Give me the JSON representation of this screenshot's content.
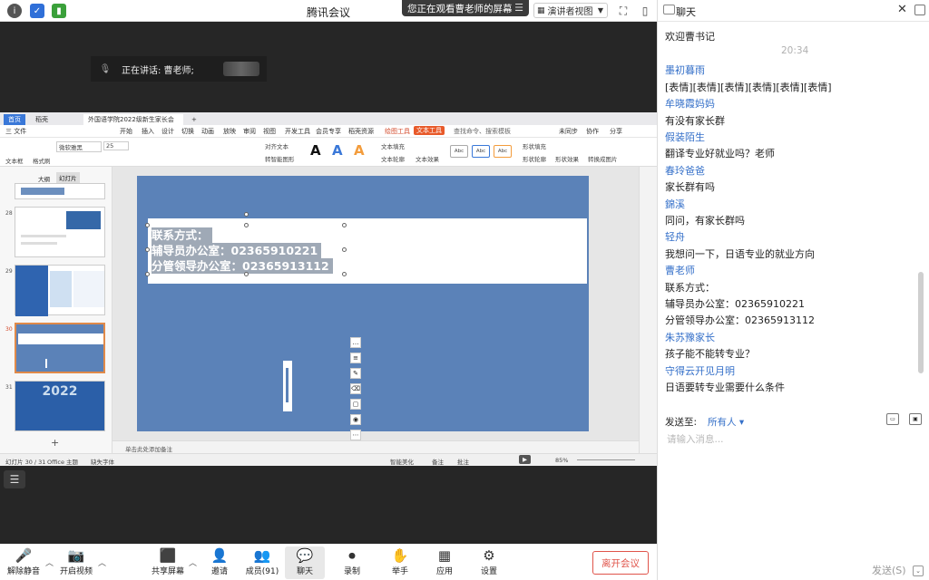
{
  "window": {
    "title": "腾讯会议",
    "viewing_notice": "您正在观看曹老师的屏幕",
    "presenter_view": "演讲者视图"
  },
  "speaking": {
    "label": "正在讲话: 曹老师;"
  },
  "wps": {
    "tabs": [
      "首页",
      "稻壳",
      "外国语学院2022级新生家长会(1)"
    ],
    "menu": [
      "三 文件",
      "开始",
      "插入",
      "设计",
      "切换",
      "动画",
      "放映",
      "审阅",
      "视图",
      "开发工具",
      "会员专享",
      "稻壳资源",
      "绘图工具",
      "文本工具",
      "查找命令、搜索模板",
      "未同步",
      "协作",
      "分享"
    ],
    "ribbon": {
      "font": "微软雅黑",
      "size": "25",
      "textbox": "文本框",
      "format": "格式刷",
      "align": "对齐文本",
      "convert": "转智能图形",
      "fill_text": "文本填充",
      "outline_text": "文本轮廓",
      "effect_text": "文本效果",
      "shape_fill": "形状填充",
      "shape_outline": "形状轮廓",
      "shape_effect": "形状效果",
      "convert_image": "转换成图片",
      "abc": "Abc"
    },
    "pane_tabs": [
      "大纲",
      "幻灯片"
    ],
    "thumbs": [
      {
        "num": "28"
      },
      {
        "num": "29"
      },
      {
        "num": "30"
      },
      {
        "num": "31"
      }
    ],
    "thumb31_text": "2022",
    "slide_lines": [
      "联系方式：",
      "辅导员办公室：02365910221",
      "分管领导办公室：02365913112"
    ],
    "notes": "单击此处添加备注",
    "status": {
      "slide": "幻灯片 30 / 31",
      "theme": "Office 主题",
      "font_missing": "缺失字体",
      "beautify": "智能美化",
      "remarks": "备注",
      "comment": "批注",
      "zoom": "85%"
    }
  },
  "toolbar": {
    "mute": "解除静音",
    "video": "开启视频",
    "share": "共享屏幕",
    "invite": "邀请",
    "members": "成员(91)",
    "chat": "聊天",
    "record": "录制",
    "raise": "举手",
    "apps": "应用",
    "settings": "设置",
    "leave": "离开会议"
  },
  "chat": {
    "title": "聊天",
    "messages": [
      {
        "kind": "text",
        "value": "欢迎曹书记"
      },
      {
        "kind": "time",
        "value": "20:34"
      },
      {
        "kind": "sender",
        "value": "墨初暮雨"
      },
      {
        "kind": "text",
        "value": "[表情][表情][表情][表情][表情][表情]"
      },
      {
        "kind": "sender",
        "value": "牟晓霞妈妈"
      },
      {
        "kind": "text",
        "value": "有没有家长群"
      },
      {
        "kind": "sender",
        "value": "假装陌生"
      },
      {
        "kind": "text",
        "value": "翻译专业好就业吗？老师"
      },
      {
        "kind": "sender",
        "value": "春玲爸爸"
      },
      {
        "kind": "text",
        "value": "家长群有吗"
      },
      {
        "kind": "sender",
        "value": "錦溪"
      },
      {
        "kind": "text",
        "value": "同问，有家长群吗"
      },
      {
        "kind": "sender",
        "value": "轻舟"
      },
      {
        "kind": "text",
        "value": "我想问一下，日语专业的就业方向"
      },
      {
        "kind": "sender",
        "value": "曹老师"
      },
      {
        "kind": "text",
        "value": "联系方式："
      },
      {
        "kind": "text",
        "value": "辅导员办公室：02365910221"
      },
      {
        "kind": "text",
        "value": "分管领导办公室：02365913112"
      },
      {
        "kind": "sender",
        "value": "朱苏豫家长"
      },
      {
        "kind": "text",
        "value": "孩子能不能转专业？"
      },
      {
        "kind": "sender",
        "value": "守得云开见月明"
      },
      {
        "kind": "text",
        "value": "日语要转专业需要什么条件"
      }
    ],
    "send_to_label": "发送至:",
    "recipient": "所有人 ▾",
    "input_placeholder": "请输入消息...",
    "send": "发送(S)"
  }
}
